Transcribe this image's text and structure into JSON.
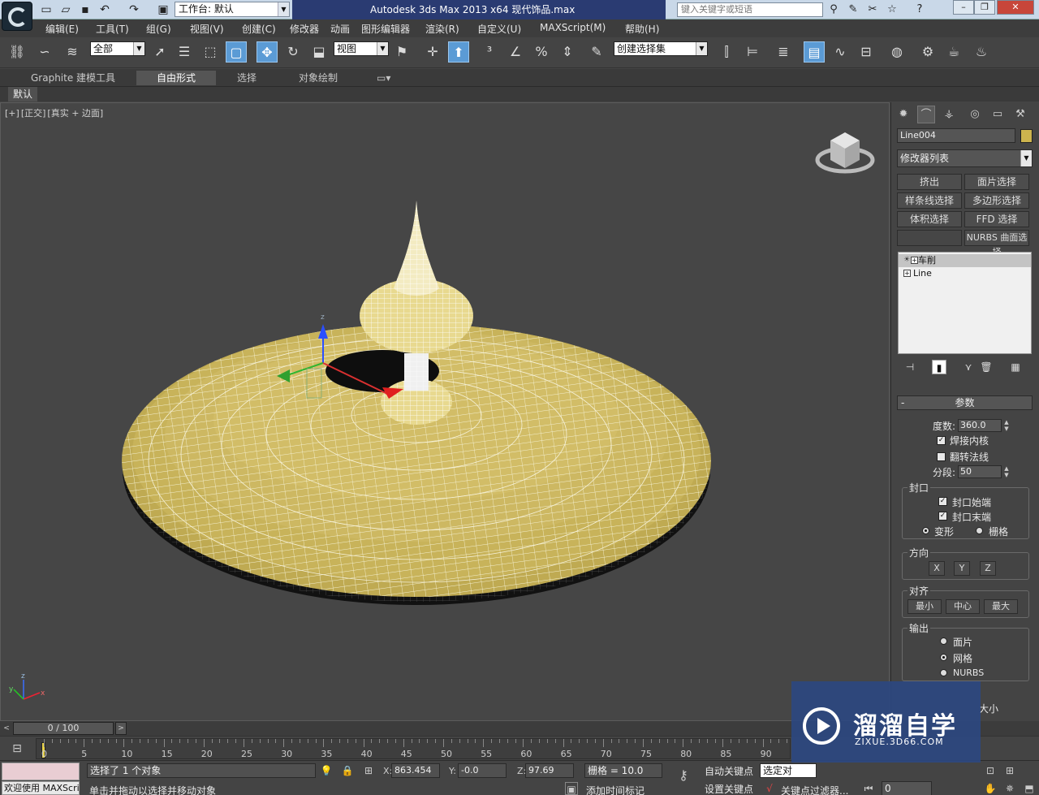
{
  "titlebar": {
    "workspace_label": "工作台: 默认",
    "app_title": "Autodesk 3ds Max  2013 x64      现代饰品.max",
    "search_placeholder": "键入关键字或短语"
  },
  "menu": [
    "编辑(E)",
    "工具(T)",
    "组(G)",
    "视图(V)",
    "创建(C)",
    "修改器",
    "动画",
    "图形编辑器",
    "渲染(R)",
    "自定义(U)",
    "MAXScript(M)",
    "帮助(H)"
  ],
  "toolbar": {
    "selection_filter": "全部",
    "ref_coord": "视图",
    "named_selection": "创建选择集"
  },
  "ribbon": {
    "tabs": [
      "Graphite 建模工具",
      "自由形式",
      "选择",
      "对象绘制"
    ],
    "active_tab": "自由形式",
    "sub_label": "默认"
  },
  "viewport": {
    "label_parts": [
      "[+]",
      "[正交]",
      "[真实 + 边面]"
    ]
  },
  "command_panel": {
    "object_name": "Line004",
    "object_color": "#cdb44e",
    "modifier_list": "修改器列表",
    "mod_buttons": [
      "挤出",
      "面片选择",
      "样条线选择",
      "多边形选择",
      "体积选择",
      "FFD 选择",
      "",
      "NURBS 曲面选择"
    ],
    "stack": [
      {
        "name": "车削",
        "selected": true
      },
      {
        "name": "Line",
        "selected": false
      }
    ],
    "params": {
      "title": "参数",
      "degrees_label": "度数:",
      "degrees_value": "360.0",
      "weld_core": "焊接内核",
      "weld_core_checked": true,
      "flip_normals": "翻转法线",
      "flip_normals_checked": false,
      "segments_label": "分段:",
      "segments_value": "50",
      "capping_title": "封口",
      "cap_start": "封口始端",
      "cap_start_checked": true,
      "cap_end": "封口末端",
      "cap_end_checked": true,
      "morph": "变形",
      "grid": "栅格",
      "morph_selected": true,
      "direction_title": "方向",
      "direction_buttons": [
        "X",
        "Y",
        "Z"
      ],
      "align_title": "对齐",
      "align_buttons": [
        "最小",
        "中心",
        "最大"
      ],
      "output_title": "输出",
      "output_options": [
        "面片",
        "网格",
        "NURBS"
      ],
      "output_selected": 1,
      "partial_text": "大小"
    }
  },
  "timeline": {
    "frame_display": "0 / 100",
    "ticks": [
      "0",
      "5",
      "10",
      "15",
      "20",
      "25",
      "30",
      "35",
      "40",
      "45",
      "50",
      "55",
      "60",
      "65",
      "70",
      "75",
      "80",
      "85",
      "90"
    ]
  },
  "status": {
    "welcome": "欢迎使用 MAXScri",
    "selection_info": "选择了 1 个对象",
    "prompt": "单击并拖动以选择并移动对象",
    "x_label": "X:",
    "x_value": "863.454",
    "y_label": "Y:",
    "y_value": "-0.0",
    "z_label": "Z:",
    "z_value": "97.69",
    "grid": "栅格 = 10.0",
    "auto_key": "自动关键点",
    "set_key": "设置关键点",
    "selected_set": "选定对",
    "add_time_tag": "添加时间标记",
    "key_filters": "关键点过滤器...",
    "frame_input": "0"
  },
  "watermark": {
    "name": "溜溜自学",
    "url": "ZIXUE.3D66.COM"
  }
}
